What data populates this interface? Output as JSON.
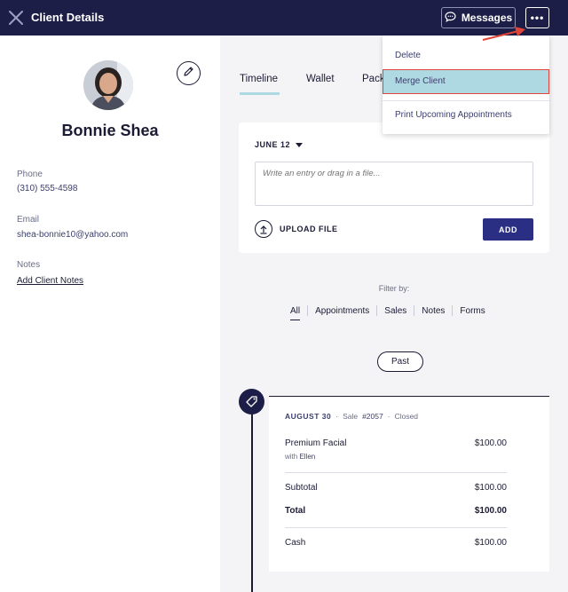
{
  "header": {
    "title": "Client Details",
    "messages_label": "Messages",
    "more_label": "•••"
  },
  "client": {
    "name": "Bonnie Shea",
    "phone_label": "Phone",
    "phone": "(310) 555-4598",
    "email_label": "Email",
    "email": "shea-bonnie10@yahoo.com",
    "notes_label": "Notes",
    "add_notes": "Add Client Notes"
  },
  "tabs": [
    {
      "label": "Timeline",
      "active": true
    },
    {
      "label": "Wallet"
    },
    {
      "label": "Pack"
    }
  ],
  "entry": {
    "date": "JUNE 12",
    "placeholder": "Write an entry or drag in a file...",
    "upload_label": "UPLOAD FILE",
    "add_label": "ADD"
  },
  "filter": {
    "label": "Filter by:",
    "items": [
      "All",
      "Appointments",
      "Sales",
      "Notes",
      "Forms"
    ]
  },
  "past_label": "Past",
  "sale": {
    "date": "AUGUST 30",
    "sale_prefix": "Sale",
    "sale_number": "#2057",
    "status": "Closed",
    "item_name": "Premium Facial",
    "item_price": "$100.00",
    "with_prefix": "with",
    "with_name": "Ellen",
    "subtotal_label": "Subtotal",
    "subtotal": "$100.00",
    "total_label": "Total",
    "total": "$100.00",
    "payment_label": "Cash",
    "payment": "$100.00"
  },
  "dropdown": {
    "items": [
      "Delete",
      "Merge Client",
      "Print Upcoming Appointments"
    ]
  },
  "colors": {
    "topbar": "#1c1e47",
    "accent": "#2b2f84",
    "highlight": "#aed9e3",
    "annotation": "#e0453a"
  }
}
